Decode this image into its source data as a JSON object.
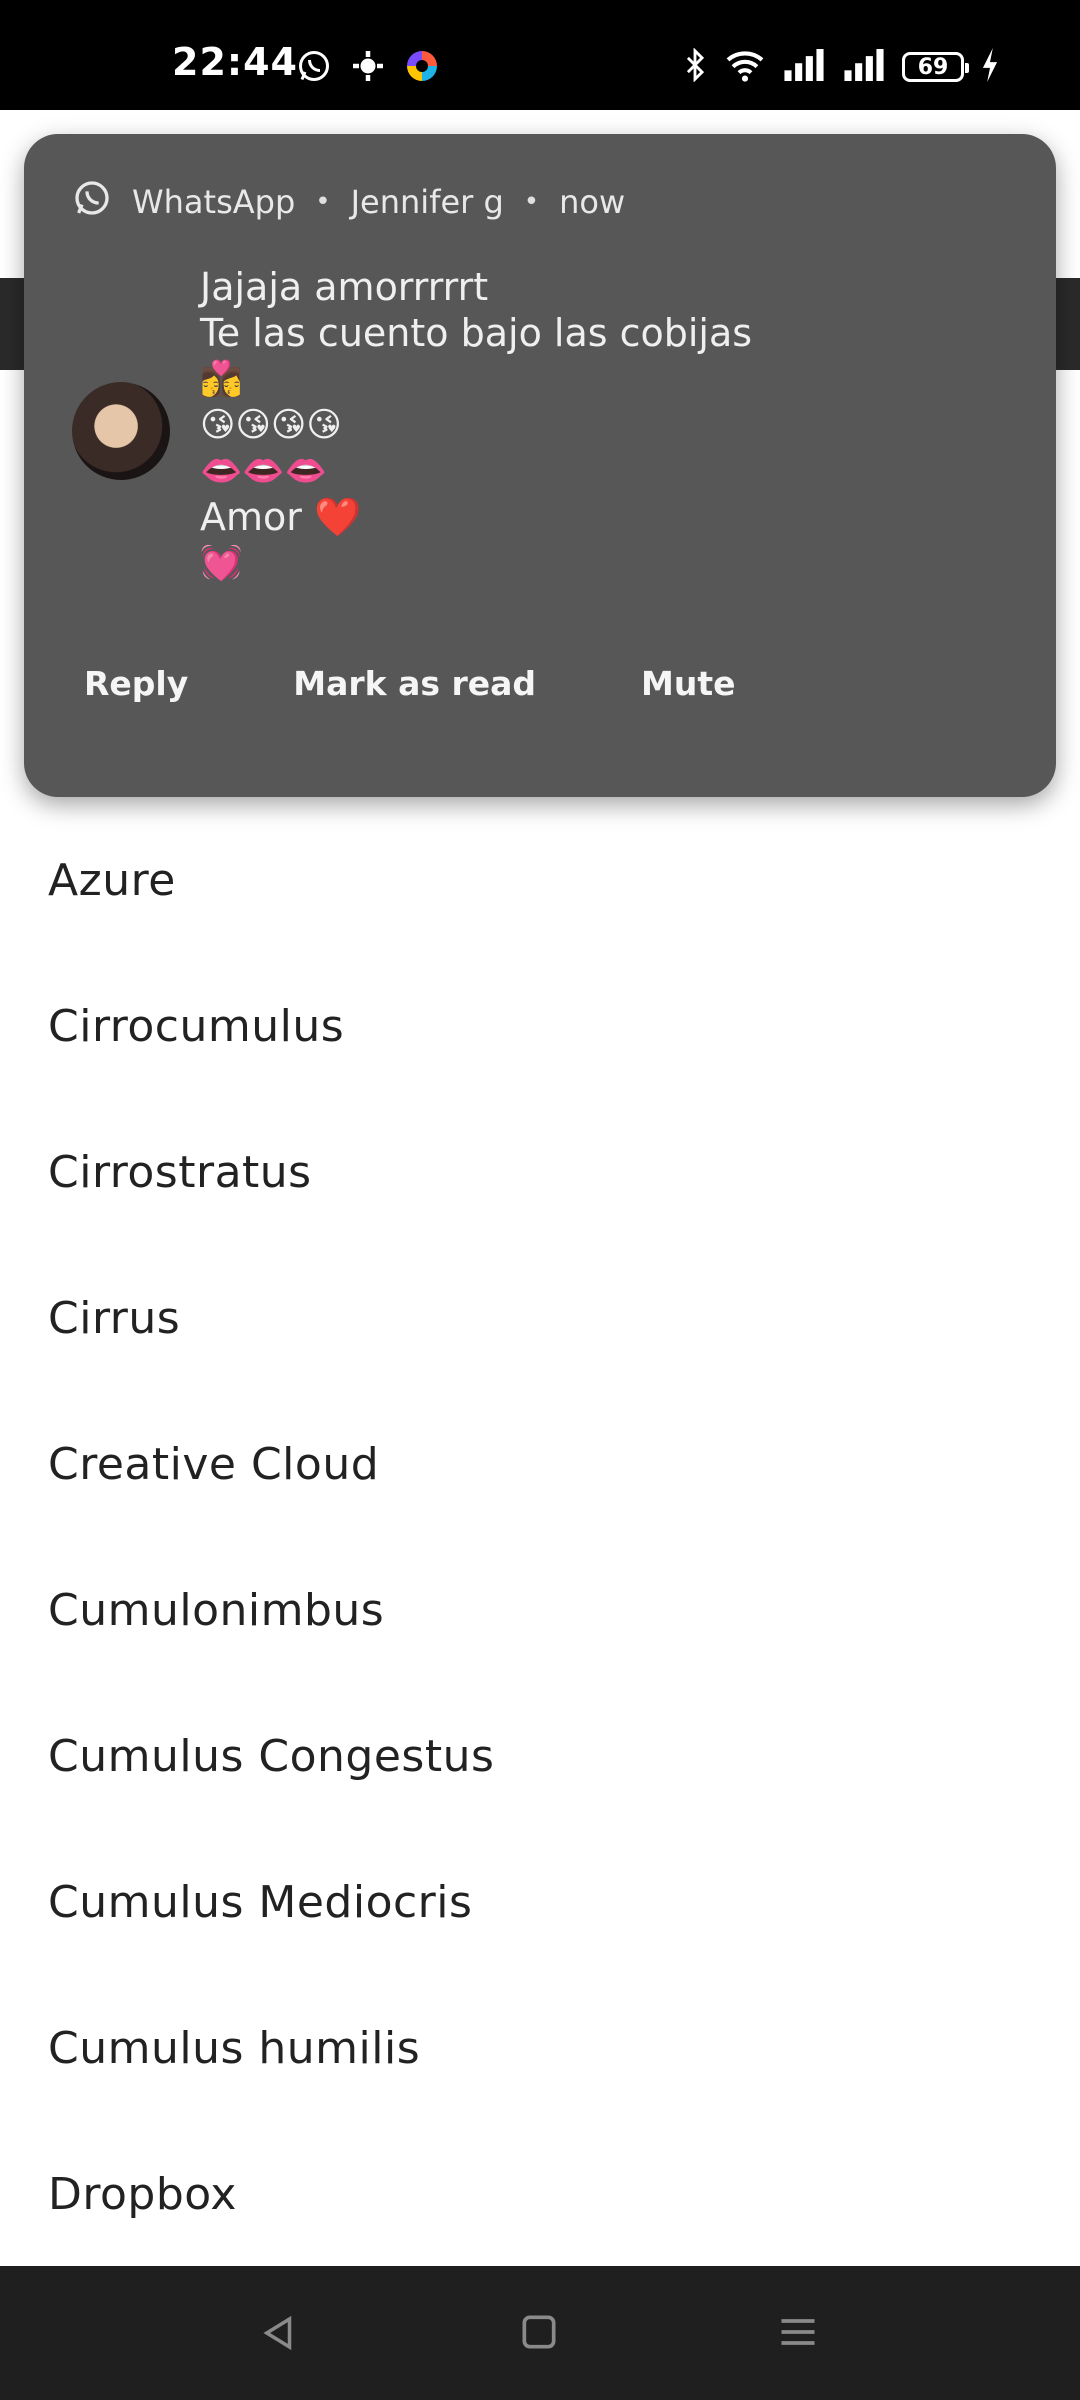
{
  "status_bar": {
    "time": "22:44",
    "battery": "69",
    "left_icons": [
      "whatsapp-icon",
      "settings-gear-icon",
      "app-color-icon"
    ],
    "right_icons": [
      "bluetooth-icon",
      "wifi-icon",
      "signal-icon",
      "signal-icon",
      "battery-icon",
      "charging-bolt-icon"
    ]
  },
  "notification": {
    "app_name": "WhatsApp",
    "sender": "Jennifer g",
    "when": "now",
    "separator": "•",
    "message_lines": [
      "Jajaja amorrrrrt",
      "Te las cuento bajo las cobijas"
    ],
    "emoji_lines": [
      "👩‍❤️‍💋‍👩",
      "😘😘😘😘",
      "👄👄👄"
    ],
    "amor_line": "Amor ❤️",
    "last_emoji": "💓",
    "actions": [
      "Reply",
      "Mark as read",
      "Mute"
    ]
  },
  "list": {
    "items": [
      "Azure",
      "Cirrocumulus",
      "Cirrostratus",
      "Cirrus",
      "Creative Cloud",
      "Cumulonimbus",
      "Cumulus Congestus",
      "Cumulus Mediocris",
      "Cumulus humilis",
      "Dropbox"
    ]
  },
  "nav_bar": {
    "buttons": [
      "back-icon",
      "home-icon",
      "menu-icon"
    ]
  }
}
